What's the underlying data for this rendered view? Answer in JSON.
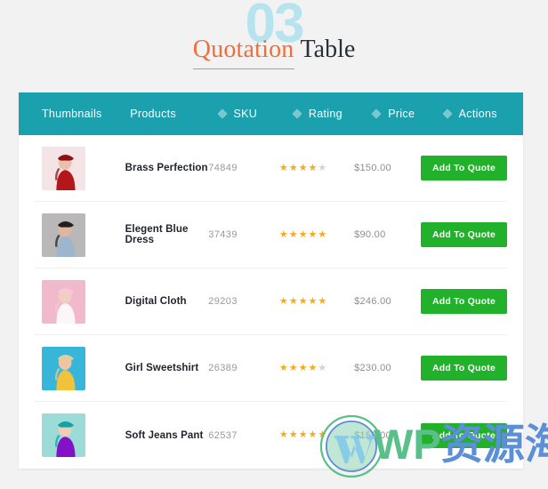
{
  "page": {
    "background_color": "#f2f2f2"
  },
  "heading": {
    "watermark_number": "03",
    "accent_word": "Quotation",
    "rest_word": "Table",
    "accent_color": "#ee6f3c",
    "rest_color": "#28313a",
    "watermark_color": "#b6e3ee"
  },
  "table": {
    "header_background": "#1ba0ad",
    "columns": [
      {
        "label": "Thumbnails",
        "sortable": false
      },
      {
        "label": "Products",
        "sortable": false
      },
      {
        "label": "SKU",
        "sortable": true
      },
      {
        "label": "Rating",
        "sortable": true
      },
      {
        "label": "Price",
        "sortable": true
      },
      {
        "label": "Actions",
        "sortable": true
      }
    ],
    "rows": [
      {
        "product": "Brass Perfection",
        "sku": "74849",
        "rating": 4,
        "rating_max": 5,
        "price": "$150.00",
        "action_label": "Add To Quote",
        "thumb": {
          "bg": "#f4e4e6",
          "subject": "#b3171c",
          "accent": "#8d1014",
          "skin": "#e8c0ab"
        }
      },
      {
        "product": "Elegent Blue Dress",
        "sku": "37439",
        "rating": 5,
        "rating_max": 5,
        "price": "$90.00",
        "action_label": "Add To Quote",
        "thumb": {
          "bg": "#b9b7b8",
          "subject": "#9db5cd",
          "accent": "#20201f",
          "skin": "#e0b79e"
        }
      },
      {
        "product": "Digital Cloth",
        "sku": "29203",
        "rating": 5,
        "rating_max": 5,
        "price": "$246.00",
        "action_label": "Add To Quote",
        "thumb": {
          "bg": "#f2b8cb",
          "subject": "#fdf6f7",
          "accent": "#f6c9d6",
          "skin": "#f0cfbe"
        }
      },
      {
        "product": "Girl Sweetshirt",
        "sku": "26389",
        "rating": 4,
        "rating_max": 5,
        "price": "$230.00",
        "action_label": "Add To Quote",
        "thumb": {
          "bg": "#37b6da",
          "subject": "#f1c33d",
          "accent": "#e2cc97",
          "skin": "#eec3a6"
        }
      },
      {
        "product": "Soft Jeans Pant",
        "sku": "62537",
        "rating": 5,
        "rating_max": 5,
        "price": "$150.00",
        "action_label": "Add To Quote",
        "thumb": {
          "bg": "#9ddbd8",
          "subject": "#8312c6",
          "accent": "#10a3a7",
          "skin": "#efcdb4"
        }
      }
    ],
    "star_on_color": "#f6ab1b",
    "star_off_color": "#d2d2d2",
    "button_color": "#21b12a"
  },
  "watermark": {
    "english_text": "WP",
    "chinese_text": "资源海",
    "english_color": "#59c08a",
    "chinese_color": "#5b8fd6"
  }
}
